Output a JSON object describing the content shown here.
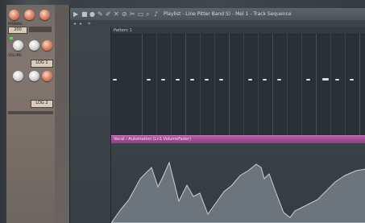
{
  "window": {
    "title": "Playlist - Line Pitter Band S) - Mel 1 - Track Sequence",
    "pattern_label": "Pattern 1",
    "clip_label": "Vocal - Automation (Ln1.VolumeFader)"
  },
  "mixer": {
    "box1": "LOG 1",
    "box2": "LOG 2",
    "value": "200",
    "label1": "PANNING",
    "label2": "VOLUME"
  },
  "colors": {
    "clip": "#a24e95",
    "automation_fill": "#6c757c",
    "note": "#d9e0e3"
  },
  "icons": [
    "play-icon",
    "stop-icon",
    "record-icon",
    "pencil-icon",
    "brush-icon",
    "delete-icon",
    "mute-icon",
    "slice-icon",
    "select-icon",
    "zoom-icon",
    "speaker-icon"
  ]
}
